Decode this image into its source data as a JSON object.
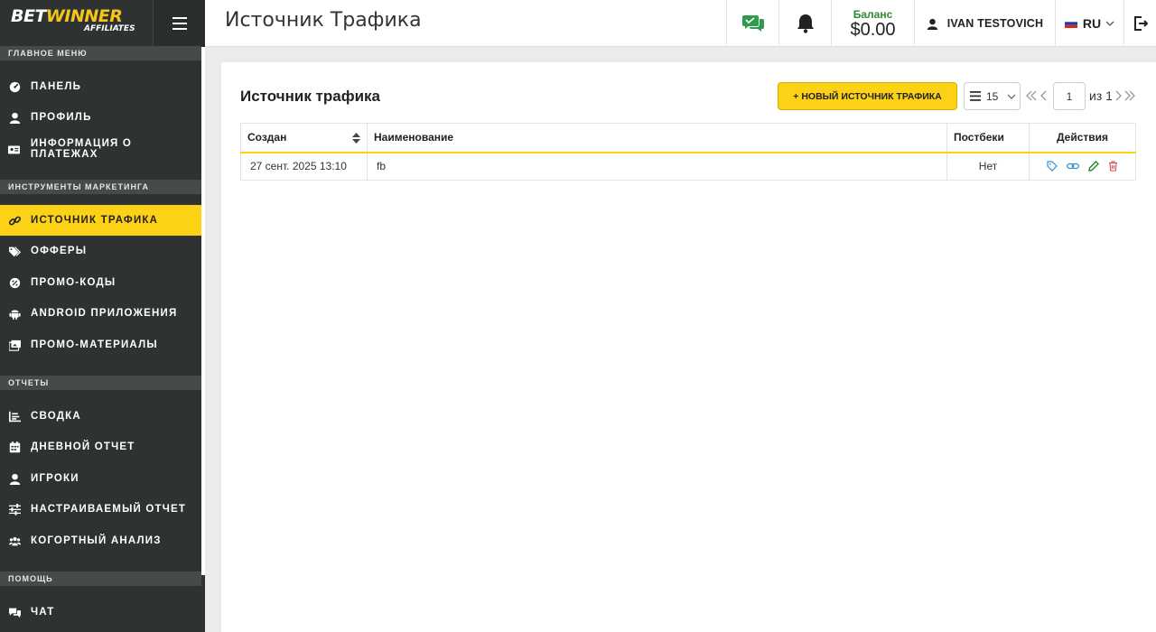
{
  "brand": {
    "logo_main": "BET",
    "logo_accent": "WINNER",
    "logo_sub": "AFFILIATES"
  },
  "topbar": {
    "title": "Источник Трафика",
    "balance_label": "Баланс",
    "balance_value": "$0.00",
    "user_name": "IVAN TESTOVICH",
    "language": "RU"
  },
  "sidebar": {
    "sections": [
      {
        "title": "Главное меню"
      },
      {
        "title": "Инструменты маркетинга"
      },
      {
        "title": "Отчеты"
      },
      {
        "title": "Помощь"
      }
    ],
    "items": [
      {
        "label": "Панель",
        "icon": "dashboard-icon"
      },
      {
        "label": "Профиль",
        "icon": "user-icon"
      },
      {
        "label": "Информация о платежах",
        "icon": "payment-card-icon"
      },
      {
        "label": "Источник трафика",
        "icon": "link-icon",
        "active": true
      },
      {
        "label": "Офферы",
        "icon": "tags-icon"
      },
      {
        "label": "Промо-коды",
        "icon": "promo-code-icon"
      },
      {
        "label": "Android приложения",
        "icon": "android-icon"
      },
      {
        "label": "Промо-материалы",
        "icon": "images-icon"
      },
      {
        "label": "Сводка",
        "icon": "chart-icon"
      },
      {
        "label": "Дневной отчет",
        "icon": "calendar-icon"
      },
      {
        "label": "Игроки",
        "icon": "player-icon"
      },
      {
        "label": "Настраиваемый отчет",
        "icon": "sliders-icon"
      },
      {
        "label": "Когортный анализ",
        "icon": "users-group-icon"
      },
      {
        "label": "Чат",
        "icon": "chat-icon"
      }
    ]
  },
  "main": {
    "card_title": "Источник трафика",
    "new_button_label": "+ НОВЫЙ ИСТОЧНИК ТРАФИКА",
    "per_page": "15",
    "page_current": "1",
    "page_of": "из 1",
    "table": {
      "columns": [
        "Создан",
        "Наименование",
        "Постбеки",
        "Действия"
      ],
      "rows": [
        {
          "created": "27 сент. 2025 13:10",
          "name": "fb",
          "postbacks": "Нет"
        }
      ]
    }
  },
  "colors": {
    "accent": "#fcd116",
    "sidebar": "#2f3233",
    "balance_label": "#2e8b2e"
  }
}
